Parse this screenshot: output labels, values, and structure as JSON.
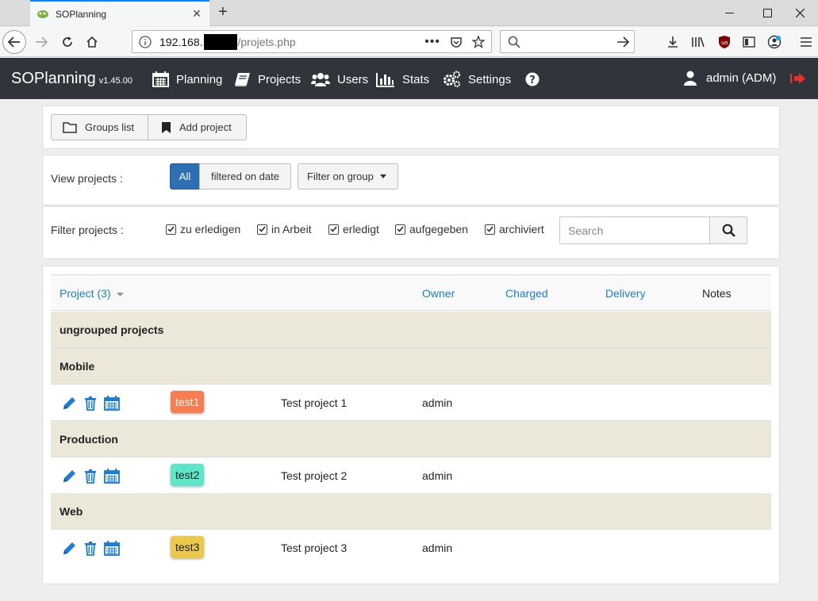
{
  "browser": {
    "tab_title": "SOPlanning",
    "url_host": "192.168.",
    "url_path": "/projets.php"
  },
  "app": {
    "brand": "SOPlanning",
    "version": "v1.45.00",
    "menu": [
      {
        "label": "Planning",
        "icon": "calendar-icon"
      },
      {
        "label": "Projects",
        "icon": "book-icon"
      },
      {
        "label": "Users",
        "icon": "users-icon"
      },
      {
        "label": "Stats",
        "icon": "bar-chart-icon"
      },
      {
        "label": "Settings",
        "icon": "gears-icon"
      }
    ],
    "help_icon": "question-circle-icon",
    "user_label": "admin (ADM)",
    "logout_icon": "logout-icon"
  },
  "toolbar": {
    "groups_list_label": "Groups list",
    "add_project_label": "Add project"
  },
  "view": {
    "label": "View projects :",
    "all_label": "All",
    "filtered_date_label": "filtered on date",
    "filter_group_label": "Filter on group"
  },
  "filter": {
    "label": "Filter projects :",
    "statuses": [
      {
        "label": "zu erledigen",
        "checked": true
      },
      {
        "label": "in Arbeit",
        "checked": true
      },
      {
        "label": "erledigt",
        "checked": true
      },
      {
        "label": "aufgegeben",
        "checked": true
      },
      {
        "label": "archiviert",
        "checked": true
      }
    ],
    "search_placeholder": "Search"
  },
  "table": {
    "columns": {
      "project": "Project (3)",
      "owner": "Owner",
      "charged": "Charged",
      "delivery": "Delivery",
      "notes": "Notes"
    },
    "ungrouped_label": "ungrouped projects",
    "groups": [
      {
        "name": "Mobile",
        "project": {
          "code": "test1",
          "name": "Test project 1",
          "owner": "admin",
          "color": "#f77c50"
        }
      },
      {
        "name": "Production",
        "project": {
          "code": "test2",
          "name": "Test project 2",
          "owner": "admin",
          "color": "#5ce8c8"
        }
      },
      {
        "name": "Web",
        "project": {
          "code": "test3",
          "name": "Test project 3",
          "owner": "admin",
          "color": "#ecc94b"
        }
      }
    ]
  },
  "colors": {
    "header_bg": "#2f353b",
    "link": "#1a7dd7",
    "primary": "#2c6fb3",
    "group_row": "#ebe8d9",
    "logout": "#e8312c"
  }
}
